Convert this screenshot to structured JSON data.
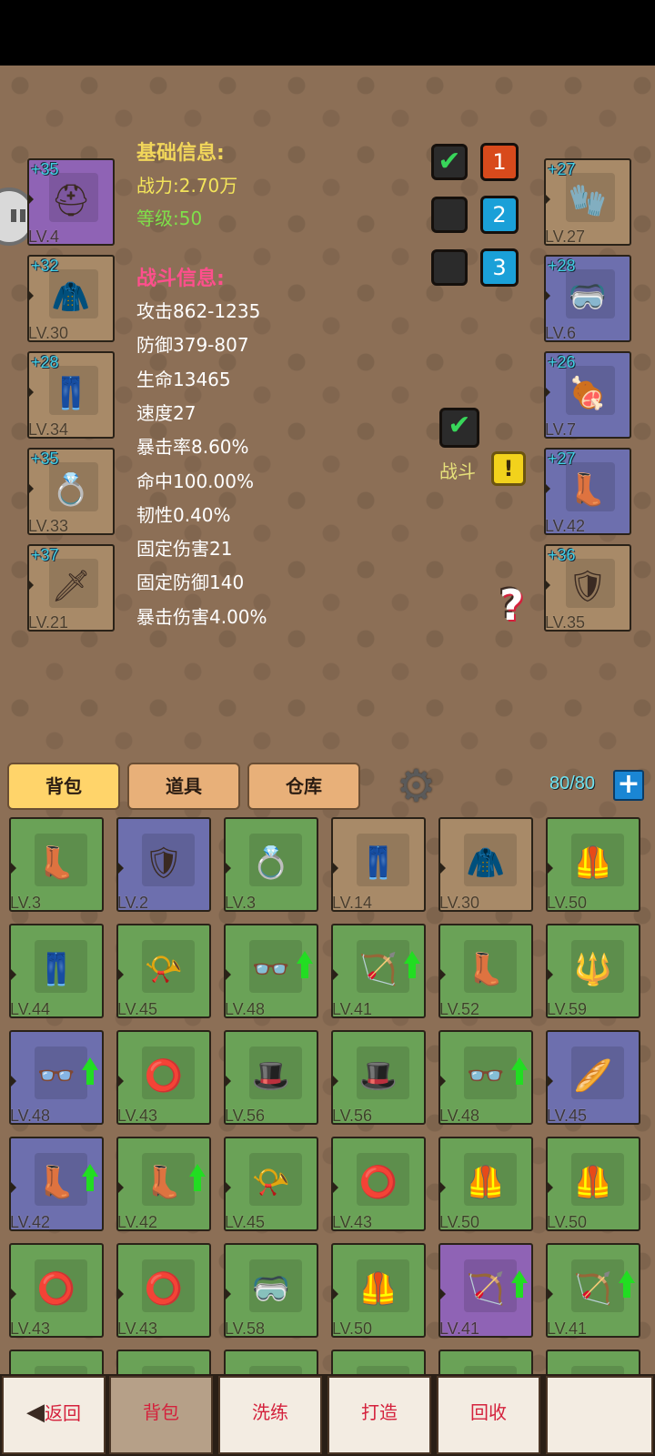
{
  "basic_info": {
    "title": "基础信息:",
    "power": "战力:2.70万",
    "level": "等级:50"
  },
  "battle_info": {
    "title": "战斗信息:",
    "stats": [
      "攻击862-1235",
      "防御379-807",
      "生命13465",
      "速度27",
      "暴击率8.60%",
      "命中100.00%",
      "韧性0.40%",
      "固定伤害21",
      "固定防御140",
      "暴击伤害4.00%"
    ]
  },
  "left_equipment": [
    {
      "plus": "+35",
      "lv": "LV.4",
      "icon": "spiked-helmet-icon",
      "glyph": "⛑",
      "quality": "purple"
    },
    {
      "plus": "+32",
      "lv": "LV.30",
      "icon": "robe-armor-icon",
      "glyph": "🧥",
      "quality": "brown"
    },
    {
      "plus": "+28",
      "lv": "LV.34",
      "icon": "pants-icon",
      "glyph": "👖",
      "quality": "brown"
    },
    {
      "plus": "+35",
      "lv": "LV.33",
      "icon": "ring-icon",
      "glyph": "💍",
      "quality": "brown"
    },
    {
      "plus": "+37",
      "lv": "LV.21",
      "icon": "sword-icon",
      "glyph": "🗡",
      "quality": "brown"
    }
  ],
  "right_equipment": [
    {
      "plus": "+27",
      "lv": "LV.27",
      "icon": "gloves-icon",
      "glyph": "🧤",
      "quality": "brown"
    },
    {
      "plus": "+28",
      "lv": "LV.6",
      "icon": "goggles-icon",
      "glyph": "🥽",
      "quality": "blue"
    },
    {
      "plus": "+26",
      "lv": "LV.7",
      "icon": "meat-icon",
      "glyph": "🍖",
      "quality": "blue"
    },
    {
      "plus": "+27",
      "lv": "LV.42",
      "icon": "boots-icon",
      "glyph": "👢",
      "quality": "blue"
    },
    {
      "plus": "+36",
      "lv": "LV.35",
      "icon": "shield-icon",
      "glyph": "🛡",
      "quality": "brown"
    }
  ],
  "presets": [
    {
      "label": "1",
      "checked": true,
      "color": "#d84a1c"
    },
    {
      "label": "2",
      "checked": false,
      "color": "#1aa0d8"
    },
    {
      "label": "3",
      "checked": false,
      "color": "#1aa0d8"
    }
  ],
  "battle_toggle": {
    "label": "战斗",
    "checked": true,
    "alert": "!"
  },
  "help": {
    "glyph": "?"
  },
  "tabs": {
    "bag": "背包",
    "items": "道具",
    "warehouse": "仓库"
  },
  "capacity": "80/80",
  "add_glyph": "+",
  "settings_glyph": "⚙",
  "inventory": [
    {
      "lv": "LV.3",
      "quality": "green",
      "icon": "boots-icon",
      "glyph": "👢",
      "up": false
    },
    {
      "lv": "LV.2",
      "quality": "blue",
      "icon": "shield-lock-icon",
      "glyph": "🛡",
      "up": false
    },
    {
      "lv": "LV.3",
      "quality": "green",
      "icon": "ring-icon",
      "glyph": "💍",
      "up": false
    },
    {
      "lv": "LV.14",
      "quality": "brown",
      "icon": "pants-icon",
      "glyph": "👖",
      "up": false
    },
    {
      "lv": "LV.30",
      "quality": "brown",
      "icon": "robe-armor-icon",
      "glyph": "🧥",
      "up": false
    },
    {
      "lv": "LV.50",
      "quality": "green",
      "icon": "armor-icon",
      "glyph": "🦺",
      "up": false
    },
    {
      "lv": "LV.44",
      "quality": "green",
      "icon": "pants-icon",
      "glyph": "👖",
      "up": false
    },
    {
      "lv": "LV.45",
      "quality": "green",
      "icon": "horn-icon",
      "glyph": "📯",
      "up": false
    },
    {
      "lv": "LV.48",
      "quality": "green",
      "icon": "glasses-icon",
      "glyph": "👓",
      "up": true
    },
    {
      "lv": "LV.41",
      "quality": "green",
      "icon": "bow-icon",
      "glyph": "🏹",
      "up": true
    },
    {
      "lv": "LV.52",
      "quality": "green",
      "icon": "boots-icon",
      "glyph": "👢",
      "up": false
    },
    {
      "lv": "LV.59",
      "quality": "green",
      "icon": "spear-icon",
      "glyph": "🔱",
      "up": false
    },
    {
      "lv": "LV.48",
      "quality": "blue",
      "icon": "glasses-icon",
      "glyph": "👓",
      "up": true
    },
    {
      "lv": "LV.43",
      "quality": "green",
      "icon": "ring-icon",
      "glyph": "⭕",
      "up": false
    },
    {
      "lv": "LV.56",
      "quality": "green",
      "icon": "cap-icon",
      "glyph": "🎩",
      "up": false
    },
    {
      "lv": "LV.56",
      "quality": "green",
      "icon": "cap-icon",
      "glyph": "🎩",
      "up": false
    },
    {
      "lv": "LV.48",
      "quality": "green",
      "icon": "glasses-icon",
      "glyph": "👓",
      "up": true
    },
    {
      "lv": "LV.45",
      "quality": "blue",
      "icon": "bread-icon",
      "glyph": "🥖",
      "up": false
    },
    {
      "lv": "LV.42",
      "quality": "blue",
      "icon": "boots-icon",
      "glyph": "👢",
      "up": true
    },
    {
      "lv": "LV.42",
      "quality": "green",
      "icon": "boots-icon",
      "glyph": "👢",
      "up": true
    },
    {
      "lv": "LV.45",
      "quality": "green",
      "icon": "horn-icon",
      "glyph": "📯",
      "up": false
    },
    {
      "lv": "LV.43",
      "quality": "green",
      "icon": "ring-icon",
      "glyph": "⭕",
      "up": false
    },
    {
      "lv": "LV.50",
      "quality": "green",
      "icon": "armor-icon",
      "glyph": "🦺",
      "up": false
    },
    {
      "lv": "LV.50",
      "quality": "green",
      "icon": "armor-icon",
      "glyph": "🦺",
      "up": false
    },
    {
      "lv": "LV.43",
      "quality": "green",
      "icon": "ring-icon",
      "glyph": "⭕",
      "up": false
    },
    {
      "lv": "LV.43",
      "quality": "green",
      "icon": "ring-icon",
      "glyph": "⭕",
      "up": false
    },
    {
      "lv": "LV.58",
      "quality": "green",
      "icon": "goggles-icon",
      "glyph": "🥽",
      "up": false
    },
    {
      "lv": "LV.50",
      "quality": "green",
      "icon": "armor-icon",
      "glyph": "🦺",
      "up": false
    },
    {
      "lv": "LV.41",
      "quality": "purple",
      "icon": "bow-icon",
      "glyph": "🏹",
      "up": true
    },
    {
      "lv": "LV.41",
      "quality": "green",
      "icon": "bow-icon",
      "glyph": "🏹",
      "up": true
    },
    {
      "lv": "",
      "quality": "green",
      "icon": "spear-icon",
      "glyph": "🗡",
      "up": false
    },
    {
      "lv": "",
      "quality": "green",
      "icon": "helmet-icon",
      "glyph": "",
      "up": false
    },
    {
      "lv": "",
      "quality": "green",
      "icon": "helmet-icon",
      "glyph": "",
      "up": false
    },
    {
      "lv": "",
      "quality": "green",
      "icon": "pants-icon",
      "glyph": "👖",
      "up": false
    },
    {
      "lv": "",
      "quality": "green",
      "icon": "spear-icon",
      "glyph": "🗡",
      "up": false
    },
    {
      "lv": "",
      "quality": "green",
      "icon": "cap-icon",
      "glyph": "🎩",
      "up": false
    }
  ],
  "bottom_nav": {
    "back": "返回",
    "back_glyph": "◀",
    "bag": "背包",
    "refine": "洗练",
    "forge": "打造",
    "recycle": "回收"
  }
}
